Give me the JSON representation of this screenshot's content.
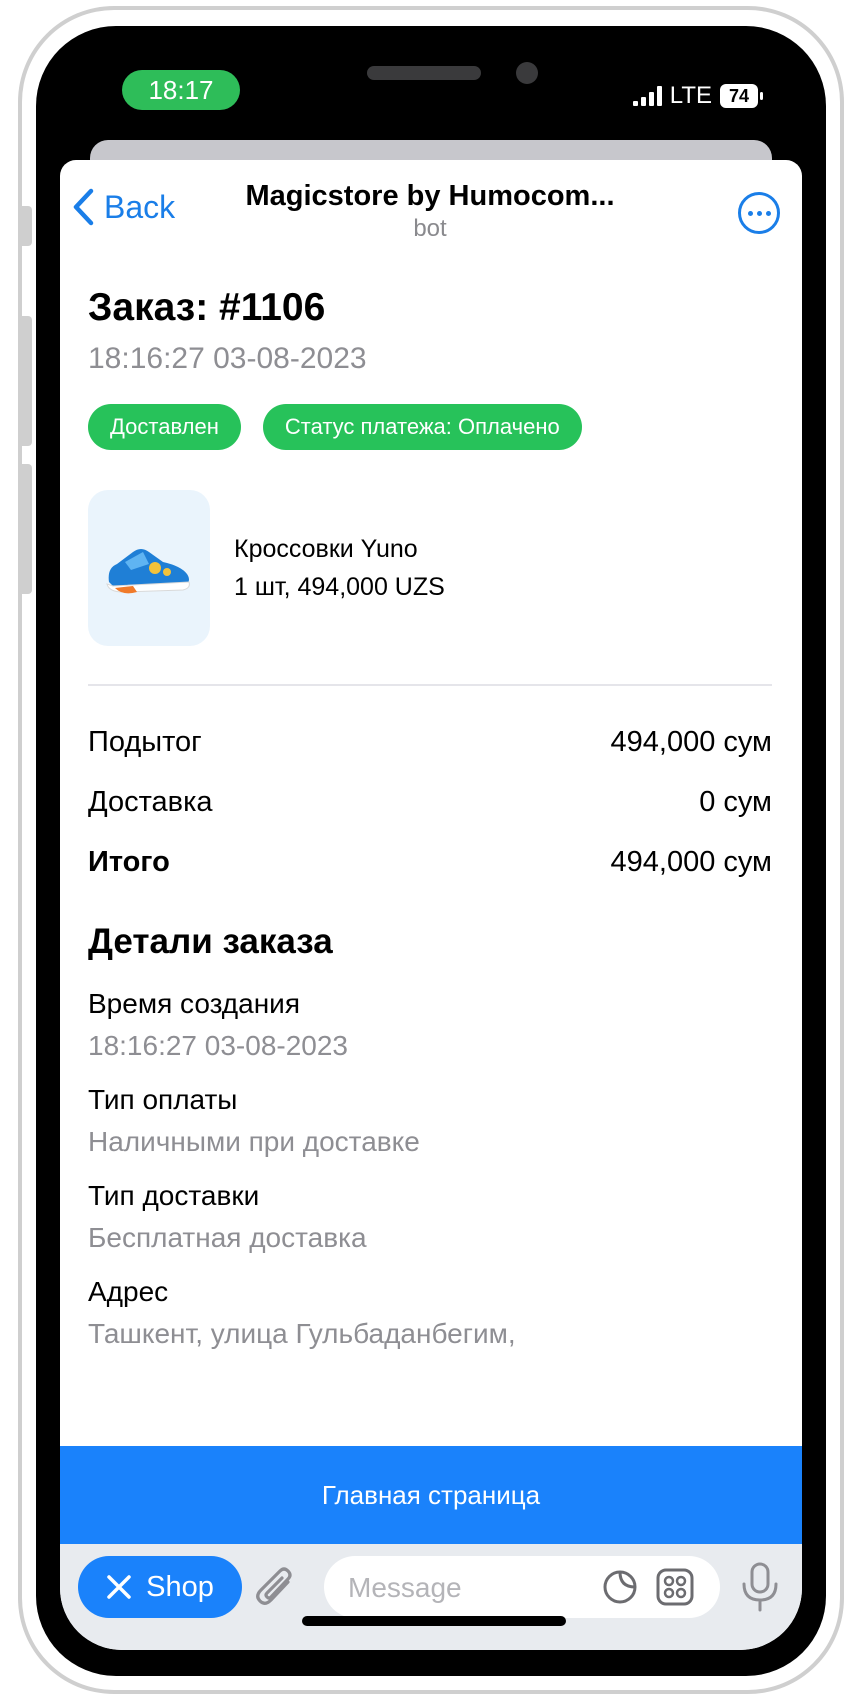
{
  "status_bar": {
    "time": "18:17",
    "network": "LTE",
    "battery": "74"
  },
  "header": {
    "back_label": "Back",
    "title": "Magicstore by Humocom...",
    "subtitle": "bot"
  },
  "order": {
    "title": "Заказ: #1106",
    "date": "18:16:27 03-08-2023",
    "badges": [
      "Доставлен",
      "Статус платежа: Оплачено"
    ]
  },
  "product": {
    "name": "Кроссовки Yuno",
    "details": "1 шт, 494,000 UZS"
  },
  "summary": [
    {
      "label": "Подытог",
      "value": "494,000 сум"
    },
    {
      "label": "Доставка",
      "value": "0 сум"
    },
    {
      "label": "Итого",
      "value": "494,000 сум"
    }
  ],
  "details": {
    "title": "Детали заказа",
    "items": [
      {
        "label": "Время создания",
        "value": "18:16:27 03-08-2023"
      },
      {
        "label": "Тип оплаты",
        "value": "Наличными при доставке"
      },
      {
        "label": "Тип доставки",
        "value": "Бесплатная доставка"
      },
      {
        "label": "Адрес",
        "value": "Ташкент, улица Гульбаданбегим,"
      }
    ]
  },
  "main_button": "Главная страница",
  "chat": {
    "shop_label": "Shop",
    "placeholder": "Message"
  },
  "colors": {
    "accent": "#1a82fb",
    "success": "#27c25a",
    "status_pill": "#2ebd59"
  }
}
